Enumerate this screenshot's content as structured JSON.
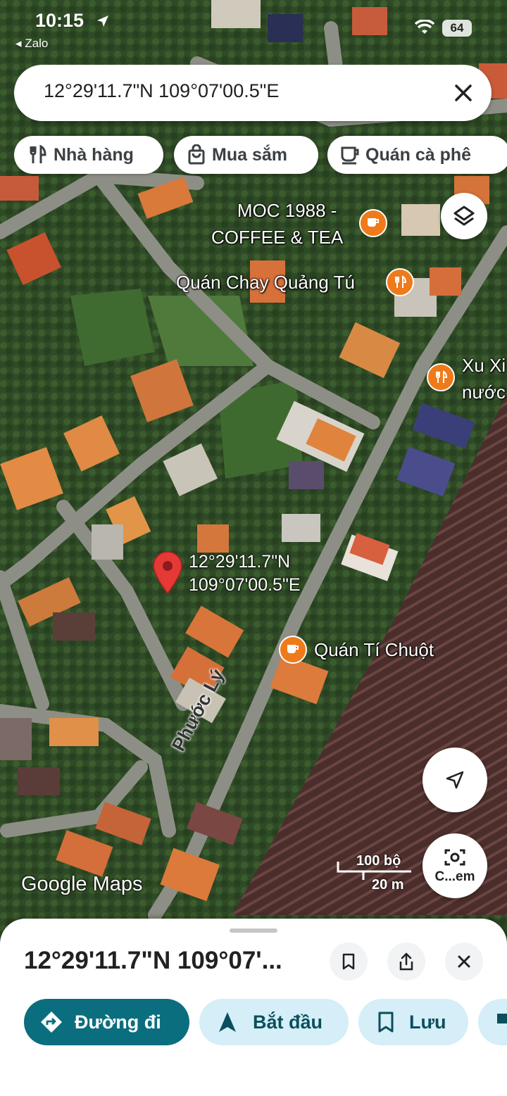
{
  "status_bar": {
    "time": "10:15",
    "back_app": "◂ Zalo",
    "battery": "64"
  },
  "search": {
    "value": "12°29'11.7\"N 109°07'00.5\"E"
  },
  "chips": [
    {
      "label": "Nhà hàng",
      "icon": "fork-knife-icon"
    },
    {
      "label": "Mua sắm",
      "icon": "shopping-bag-icon"
    },
    {
      "label": "Quán cà phê",
      "icon": "coffee-cup-icon"
    }
  ],
  "pois": {
    "moc_line1": "MOC 1988 -",
    "moc_line2": "COFFEE & TEA",
    "quan_chay": "Quán Chay Quảng Tú",
    "xu_line1": "Xu Xi",
    "xu_line2": "nước",
    "ti_chuot": "Quán Tí Chuột"
  },
  "road_label": "Phước Lý",
  "pin": {
    "lat": "12°29'11.7\"N",
    "lng": "109°07'00.5\"E"
  },
  "map_branding": "Google Maps",
  "scale": {
    "feet": "100 bộ",
    "meters": "20 m"
  },
  "camera_button_label": "C...em",
  "sheet": {
    "title": "12°29'11.7\"N 109°07'..."
  },
  "actions": {
    "directions": "Đường đi",
    "start": "Bắt đầu",
    "save": "Lưu"
  },
  "colors": {
    "primary": "#0b6e7e",
    "light_chip": "#d5eef8",
    "poi_orange": "#ef7a1a",
    "pin_red": "#e53935"
  }
}
